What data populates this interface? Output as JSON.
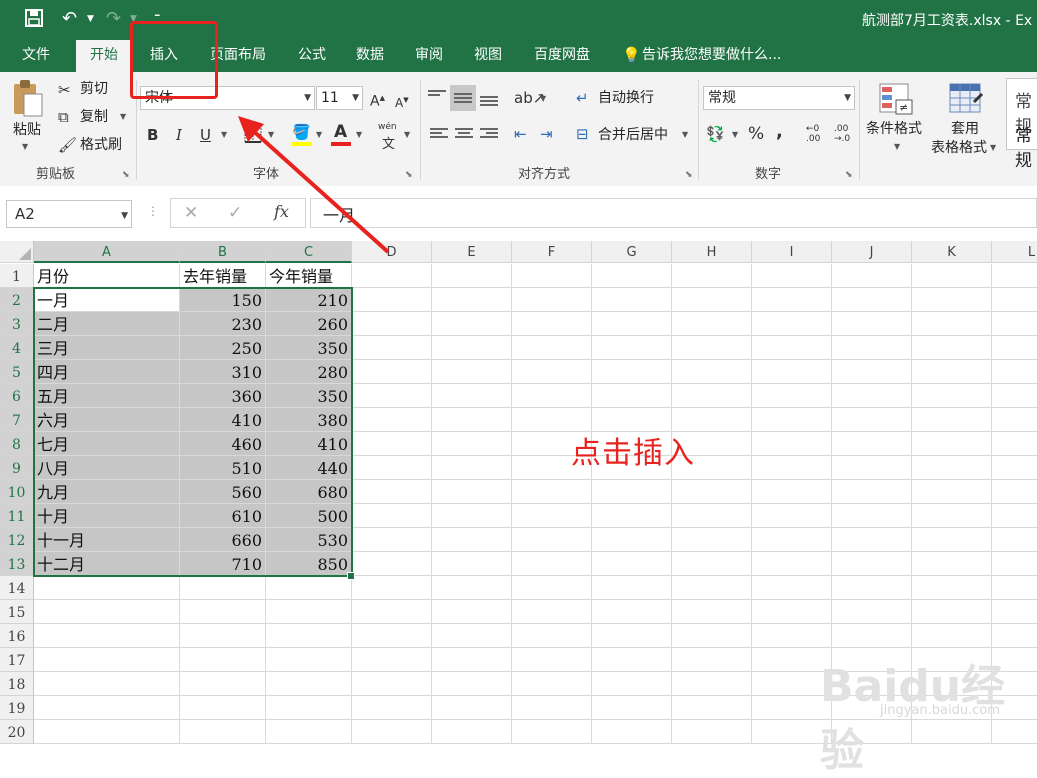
{
  "window": {
    "title": "航测部7月工资表.xlsx - Ex"
  },
  "tabs": [
    "文件",
    "开始",
    "插入",
    "页面布局",
    "公式",
    "数据",
    "审阅",
    "视图",
    "百度网盘"
  ],
  "tell_me": "告诉我您想要做什么...",
  "ribbon": {
    "clipboard": {
      "paste": "粘贴",
      "cut": "剪切",
      "copy": "复制",
      "format_painter": "格式刷",
      "group": "剪贴板"
    },
    "font": {
      "name": "宋体",
      "size": "11",
      "bold": "B",
      "italic": "I",
      "underline": "U",
      "color_letter": "A",
      "wen": "wén",
      "group": "字体"
    },
    "alignment": {
      "wrap": "自动换行",
      "merge": "合并后居中",
      "group": "对齐方式"
    },
    "number": {
      "format": "常规",
      "percent": "%",
      "comma": ",",
      "group": "数字"
    },
    "styles": {
      "cond_format": "条件格式",
      "table_format_1": "套用",
      "table_format_2": "表格格式",
      "cell_style": "常规",
      "cell_style_2": "常规"
    }
  },
  "formula_bar": {
    "name_box": "A2",
    "fx": "fx",
    "value": "一月"
  },
  "sheet": {
    "columns": [
      "A",
      "B",
      "C",
      "D",
      "E",
      "F",
      "G",
      "H",
      "I",
      "J",
      "K",
      "L"
    ],
    "rows": [
      "1",
      "2",
      "3",
      "4",
      "5",
      "6",
      "7",
      "8",
      "9",
      "10",
      "11",
      "12",
      "13",
      "14",
      "15",
      "16",
      "17",
      "18",
      "19",
      "20"
    ],
    "headers": [
      "月份",
      "去年销量",
      "今年销量"
    ],
    "data": [
      [
        "一月",
        "150",
        "210"
      ],
      [
        "二月",
        "230",
        "260"
      ],
      [
        "三月",
        "250",
        "350"
      ],
      [
        "四月",
        "310",
        "280"
      ],
      [
        "五月",
        "360",
        "350"
      ],
      [
        "六月",
        "410",
        "380"
      ],
      [
        "七月",
        "460",
        "410"
      ],
      [
        "八月",
        "510",
        "440"
      ],
      [
        "九月",
        "560",
        "680"
      ],
      [
        "十月",
        "610",
        "500"
      ],
      [
        "十一月",
        "660",
        "530"
      ],
      [
        "十二月",
        "710",
        "850"
      ]
    ]
  },
  "annotation": {
    "text": "点击插入",
    "color": "#e8231f"
  },
  "watermark": {
    "text": "Baidu经验",
    "sub": "jingyan.baidu.com"
  },
  "colors": {
    "accent": "#217346",
    "annotation": "#e8231f"
  }
}
